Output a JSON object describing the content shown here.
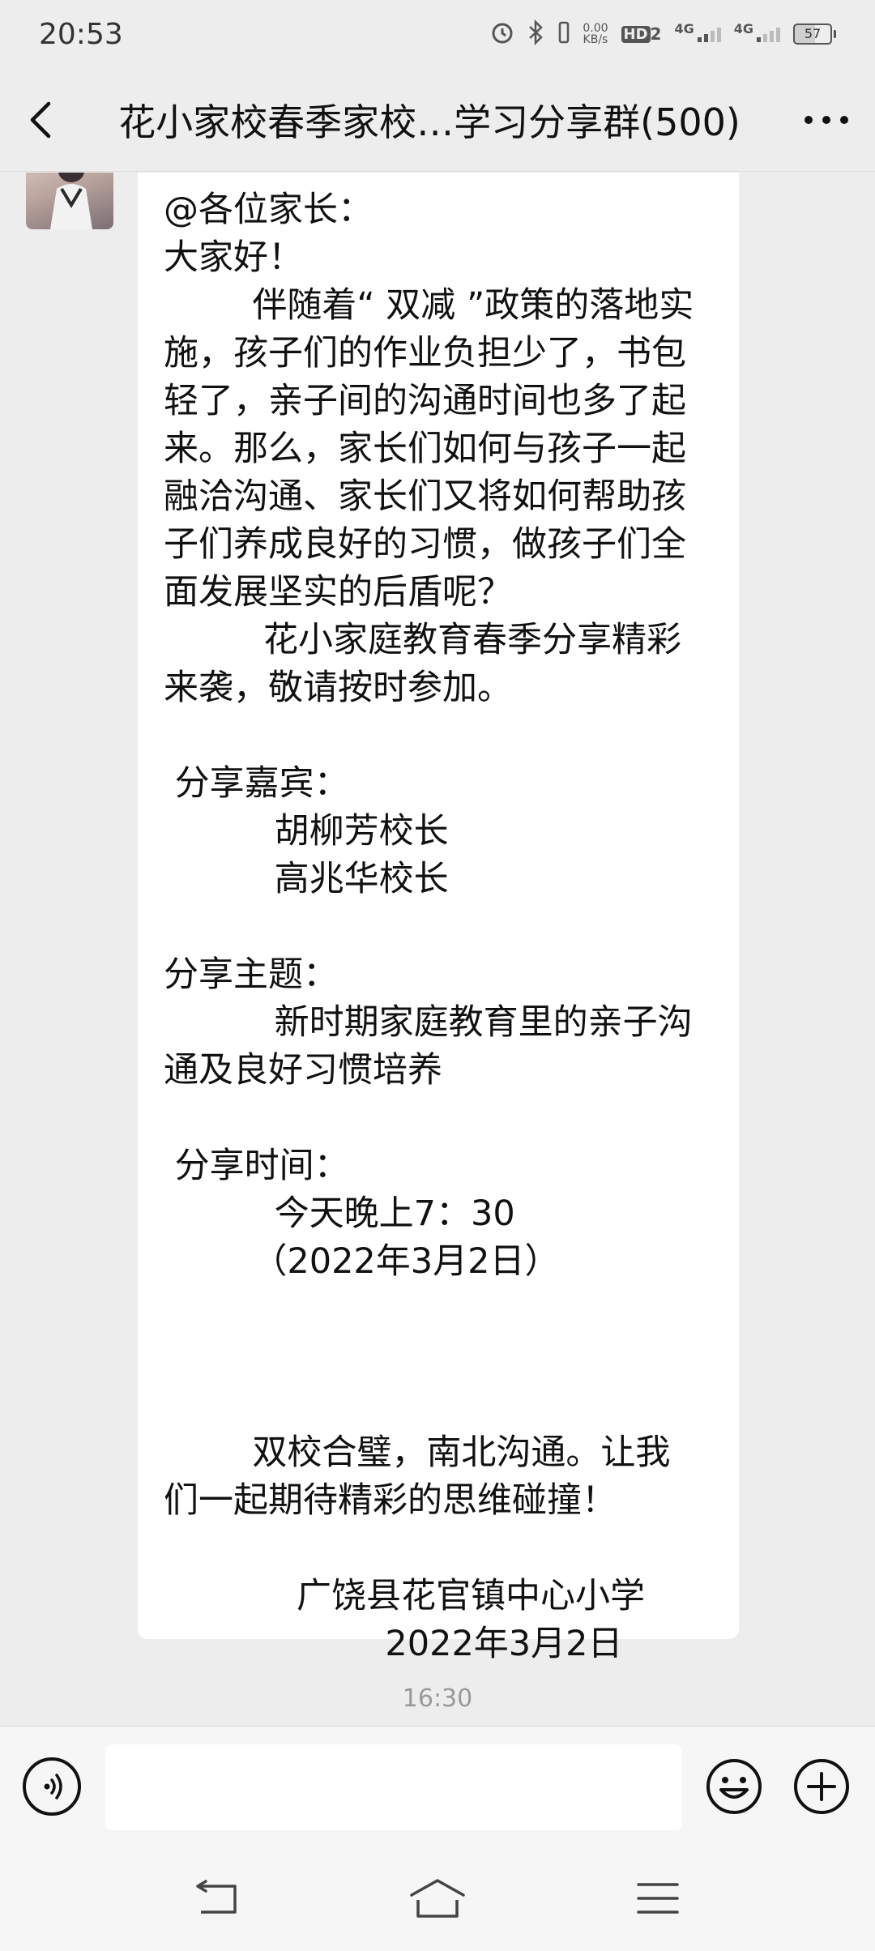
{
  "status_bar": {
    "time": "20:53",
    "net_speed_value": "0.00",
    "net_speed_unit": "KB/s",
    "hd_label": "HD",
    "hd_sub": "2",
    "signal_1_label": "4G",
    "signal_2_label": "4G",
    "battery_level": "57"
  },
  "header": {
    "title": "花小家校春季家校…学习分享群(500)"
  },
  "message": {
    "lines": [
      "@各位家长：",
      "大家好！",
      "        伴随着“ 双减 ”政策的落地实",
      "施，孩子们的作业负担少了，书包",
      "轻了，亲子间的沟通时间也多了起",
      "来。那么，家长们如何与孩子一起",
      "融洽沟通、家长们又将如何帮助孩",
      "子们养成良好的习惯，做孩子们全",
      "面发展坚实的后盾呢？",
      "         花小家庭教育春季分享精彩",
      "来袭，敬请按时参加。",
      "",
      " 分享嘉宾：",
      "          胡柳芳校长",
      "          高兆华校长",
      "",
      "分享主题：",
      "          新时期家庭教育里的亲子沟",
      "通及良好习惯培养",
      "",
      " 分享时间：",
      "          今天晚上7：30",
      "        （2022年3月2日）",
      "",
      "",
      "",
      "        双校合璧，南北沟通。让我",
      "们一起期待精彩的思维碰撞！",
      "",
      "            广饶县花官镇中心小学",
      "                    2022年3月2日"
    ]
  },
  "timestamp": "16:30",
  "input": {
    "placeholder": ""
  }
}
